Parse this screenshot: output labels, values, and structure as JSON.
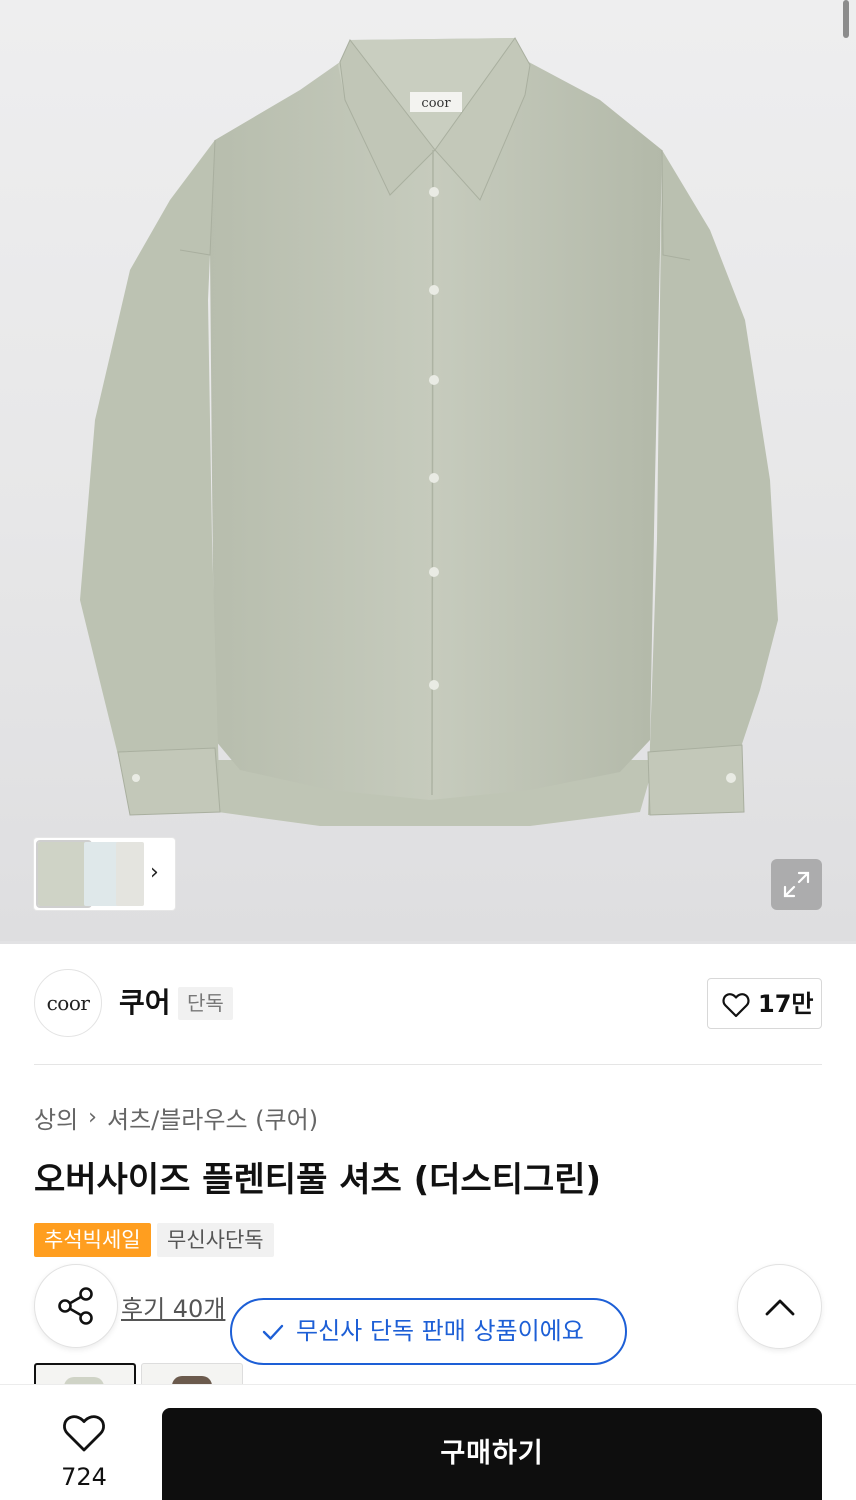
{
  "gallery": {
    "image_alt": "오버사이즈 플렌티풀 셔츠 (더스티그린)",
    "label_text": "coor",
    "thumbnails_count_visible": 3,
    "thumbnail_more_icon": "chevron-right-icon",
    "expand_icon": "expand-icon"
  },
  "brand": {
    "logo_text": "coor",
    "name": "쿠어",
    "badge": "단독",
    "like_icon": "heart-outline-icon",
    "like_count": "17만"
  },
  "breadcrumb": {
    "category": "상의",
    "separator": "›",
    "subcategory": "셔츠/블라우스 (쿠어)"
  },
  "product": {
    "title": "오버사이즈 플렌티풀 셔츠 (더스티그린)",
    "tags": [
      "추석빅세일",
      "무신사단독"
    ],
    "review_link": "후기 40개"
  },
  "toast": {
    "icon": "check-icon",
    "message": "무신사 단독 판매 상품이에요"
  },
  "colors": {
    "accent_sale": "#ff9e1f",
    "accent_blue": "#1d5fd6",
    "buy_button": "#0e0e0e"
  },
  "bottom_bar": {
    "wish_icon": "heart-outline-icon",
    "wish_count": "724",
    "buy_label": "구매하기"
  }
}
